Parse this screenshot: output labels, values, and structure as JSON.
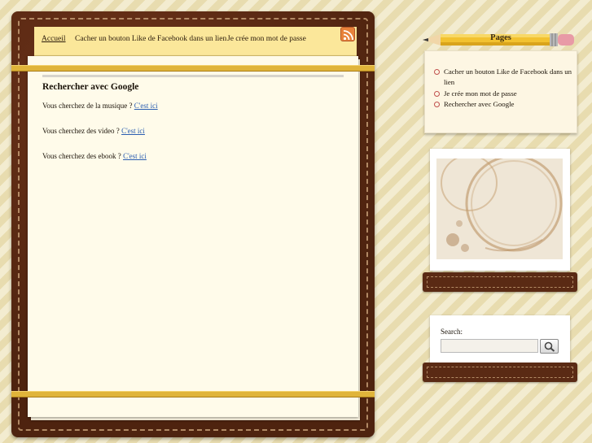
{
  "nav": {
    "items": [
      {
        "label": "Accueil",
        "active": true
      },
      {
        "label": "Cacher un bouton Like de Facebook dans un lien",
        "active": false
      },
      {
        "label": "Je crée mon mot de passe",
        "active": false
      }
    ],
    "rss_icon": "rss-icon"
  },
  "post": {
    "title": "Rechercher avec Google",
    "lines": [
      {
        "text": "Vous cherchez de la musique ?",
        "link": "C'est ici"
      },
      {
        "text": "Vous cherchez des video ?",
        "link": "C'est ici"
      },
      {
        "text": "Vous cherchez des ebook ?",
        "link": "C'est ici"
      }
    ]
  },
  "sidebar": {
    "pages_title": "Pages",
    "pages": [
      {
        "label": "Cacher un bouton Like de Facebook dans un lien"
      },
      {
        "label": "Je crée mon mot de passe"
      },
      {
        "label": "Rechercher avec Google"
      }
    ],
    "search": {
      "label": "Search:",
      "value": "",
      "button_icon": "magnifier-icon"
    }
  },
  "colors": {
    "leather": "#5a2a14",
    "nav_bg": "#fbe79a",
    "paper": "#fffbea",
    "band": "#e0b43a",
    "link": "#2a5db0",
    "bullet": "#c0504d"
  }
}
